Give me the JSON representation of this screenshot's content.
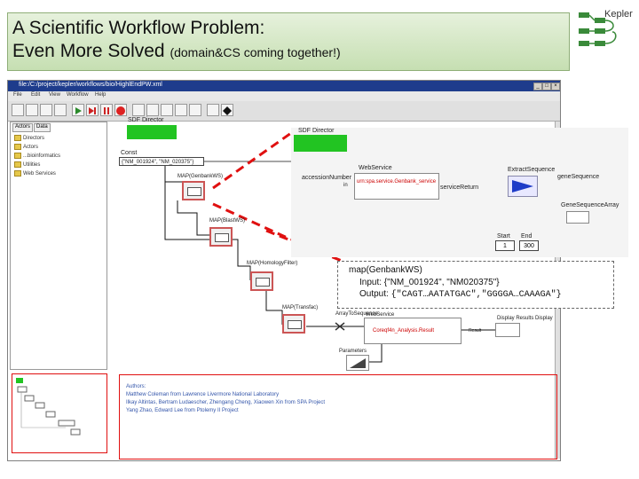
{
  "slide": {
    "title_line1": "A Scientific Workflow Problem:",
    "title_line2": "Even More Solved",
    "title_line2_suffix": "(domain&CS coming together!)",
    "logo_text": "Kepler"
  },
  "window": {
    "title": "file:/C:/project/kepler/workflows/bio/HighlEndPW.xml",
    "buttons": [
      "_",
      "□",
      "×"
    ],
    "menu": [
      "File",
      "Edit",
      "View",
      "Workflow",
      "Help"
    ],
    "tabs": [
      "Actors",
      "Data"
    ],
    "tree": [
      "Directors",
      "Actors",
      "...bioinformatics",
      "Utilities",
      "Web Services"
    ]
  },
  "canvas": {
    "sdf_director1": "SDF Director",
    "const_label": "Const",
    "const_value": "{\"NM_001924\", \"NM_020375\"}",
    "map_genbank": "MAP(GenbankWS)",
    "map_blast": "MAP(BlastWS)",
    "map_homology": "MAP(HomologyFilter)",
    "map_transfac": "MAP(Transfac)",
    "sdf_director2": "SDF Director",
    "accession": "accessionNumber",
    "in_port": "in",
    "webservice": "WebService",
    "ws_url": "urn:spa.service.Genbank_service",
    "service_return": "serviceReturn",
    "extract": "ExtractSequence",
    "gene_sequence": "geneSequence",
    "gene_sequence_array": "GeneSequenceArray",
    "start_label": "Start",
    "start_value": "1",
    "end_label": "End",
    "end_value": "300",
    "array_to_sequence": "ArrayToSequence",
    "ws2_label": "WebService",
    "ws2_url": "Coreqf4n_Analysis.Result",
    "display_label": "Display Results Display",
    "result_port": "Result",
    "parameters": "Parameters",
    "authors": [
      "Authors:",
      "Matthew Coleman from Lawrence Livermore National Laboratory",
      "Ilkay Altintas, Bertram Ludaescher, Zhengang Cheng, Xiaowen Xin from SPA Project",
      "Yang Zhao, Edward Lee from Ptolemy II Project"
    ]
  },
  "callout": {
    "line1": "map(GenbankWS)",
    "line2": "Input: {\"NM_001924\", \"NM020375\"}",
    "line3_prefix": "Output: ",
    "line3_value": "{\"CAGT…AATATGAC\",\"GGGGA…CAAAGA\"}"
  },
  "colors": {
    "director_green": "#22c422",
    "title_bg": "#cfe4bd",
    "red_dashes": "#e01010",
    "titlebar_blue": "#1e3c8c"
  },
  "icons": [
    "kepler-logo-icon",
    "play-icon",
    "pause-icon",
    "stop-icon",
    "zoom-in-icon",
    "zoom-out-icon",
    "zoom-fit-icon",
    "folder-icon"
  ]
}
